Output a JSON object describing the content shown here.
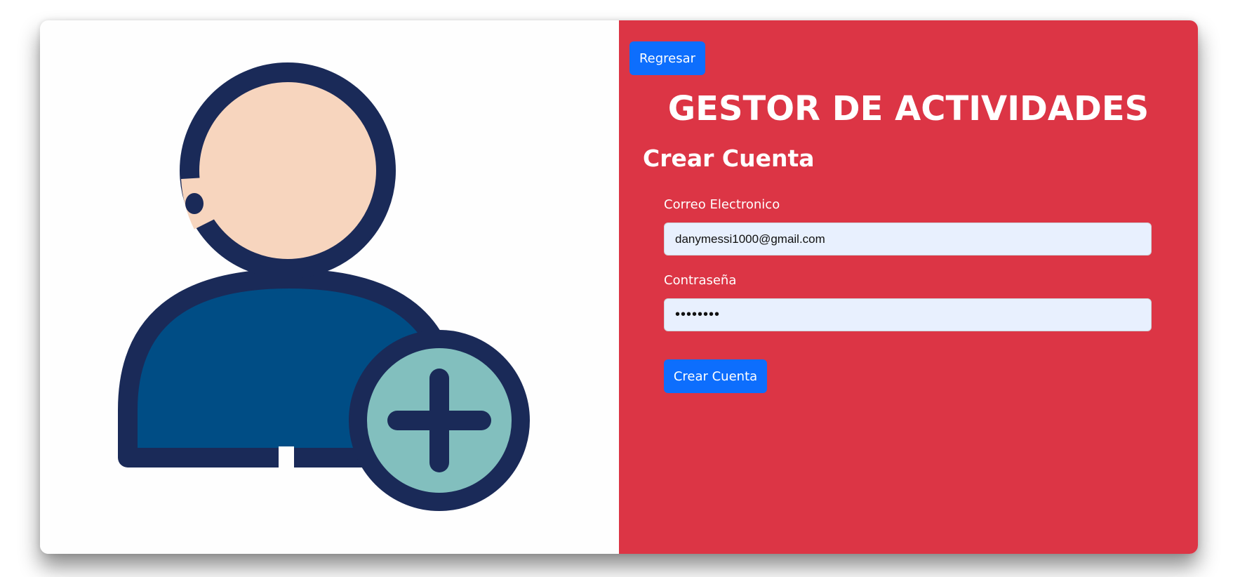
{
  "header": {
    "back_label": "Regresar",
    "app_title": "GESTOR DE ACTIVIDADES"
  },
  "form": {
    "title": "Crear Cuenta",
    "email_label": "Correo Electronico",
    "email_value": "danymessi1000@gmail.com",
    "password_label": "Contraseña",
    "password_value": "12345678",
    "submit_label": "Crear Cuenta"
  },
  "illustration": {
    "icon": "add-user-icon"
  },
  "colors": {
    "right_panel": "#dc3545",
    "button": "#0d6efd",
    "input_bg": "#e8f0fe",
    "outline": "#1a2a58",
    "skin": "#f7d5be",
    "body": "#004d85",
    "plus_circle": "#82bfbe"
  }
}
